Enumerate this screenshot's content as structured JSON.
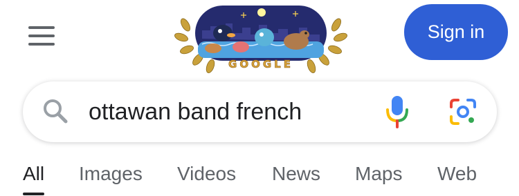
{
  "header": {
    "menu_icon": "hamburger-menu-icon",
    "doodle_text": "GOOGLE",
    "signin_label": "Sign in"
  },
  "search": {
    "query": "ottawan band french",
    "icons": [
      "search-icon",
      "microphone-icon",
      "google-lens-icon"
    ]
  },
  "tabs": [
    {
      "label": "All",
      "active": true
    },
    {
      "label": "Images"
    },
    {
      "label": "Videos"
    },
    {
      "label": "News"
    },
    {
      "label": "Maps"
    },
    {
      "label": "Web"
    }
  ],
  "colors": {
    "signin_bg": "#2f5fd5",
    "text_primary": "#202124",
    "text_secondary": "#5f6368",
    "mic_blue": "#4285f4",
    "mic_red": "#ea4335",
    "mic_yellow": "#fbbc04",
    "mic_green": "#34a853"
  }
}
